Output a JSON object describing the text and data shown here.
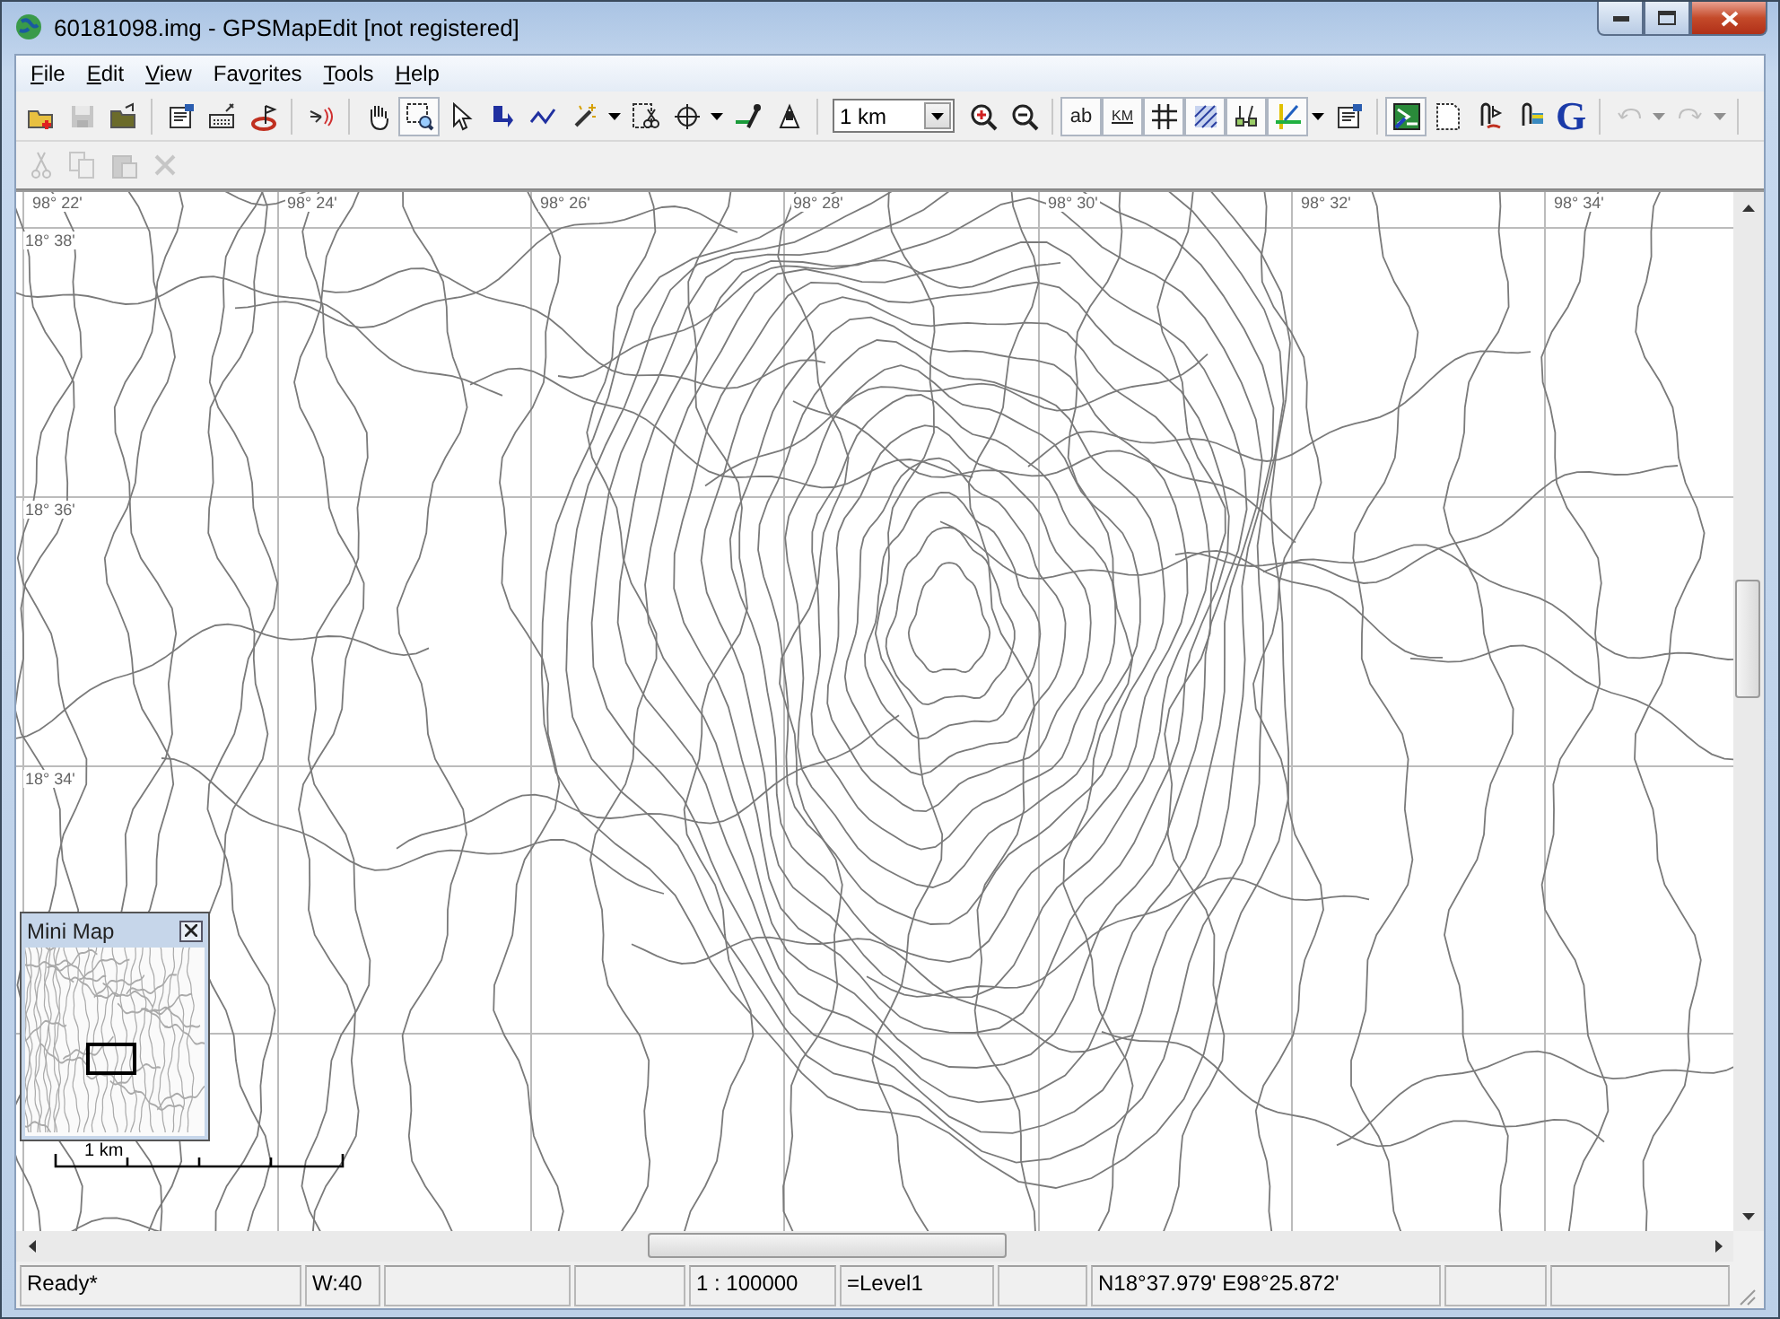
{
  "window": {
    "title": "60181098.img - GPSMapEdit [not registered]"
  },
  "menu": [
    {
      "key": "F",
      "post": "ile"
    },
    {
      "key": "E",
      "post": "dit"
    },
    {
      "key": "V",
      "post": "iew"
    },
    {
      "pre": "Fav",
      "key": "o",
      "post": "rites"
    },
    {
      "key": "T",
      "post": "ools"
    },
    {
      "key": "H",
      "post": "elp"
    }
  ],
  "toolbar": [
    {
      "kind": "button",
      "pressed": false,
      "disabled": false
    },
    {
      "kind": "button",
      "pressed": false,
      "disabled": true
    },
    {
      "kind": "button",
      "pressed": false,
      "disabled": false
    },
    {
      "kind": "separator"
    },
    {
      "kind": "button",
      "pressed": false,
      "disabled": false
    },
    {
      "kind": "button",
      "pressed": false,
      "disabled": false
    },
    {
      "kind": "button",
      "pressed": false,
      "disabled": false
    },
    {
      "kind": "separator"
    },
    {
      "kind": "button",
      "pressed": false,
      "disabled": false
    },
    {
      "kind": "separator"
    },
    {
      "kind": "button",
      "pressed": false,
      "disabled": false
    },
    {
      "kind": "button",
      "pressed": true,
      "disabled": false
    },
    {
      "kind": "button",
      "pressed": false,
      "disabled": false
    },
    {
      "kind": "button",
      "pressed": false,
      "disabled": false
    },
    {
      "kind": "button",
      "pressed": false,
      "disabled": false
    },
    {
      "kind": "button",
      "pressed": false,
      "disabled": false
    },
    {
      "kind": "dropdown",
      "disabled": false
    },
    {
      "kind": "button",
      "pressed": false,
      "disabled": false
    },
    {
      "kind": "button",
      "pressed": false,
      "disabled": false
    },
    {
      "kind": "dropdown",
      "disabled": false
    },
    {
      "kind": "button",
      "pressed": false,
      "disabled": false
    },
    {
      "kind": "button",
      "pressed": false,
      "disabled": false
    },
    {
      "kind": "separator"
    },
    {
      "kind": "combo",
      "value": "1 km"
    },
    {
      "kind": "button",
      "pressed": false,
      "disabled": false
    },
    {
      "kind": "button",
      "pressed": false,
      "disabled": false
    },
    {
      "kind": "separator"
    },
    {
      "kind": "text-button",
      "label": "ab",
      "pressed": true,
      "disabled": false
    },
    {
      "kind": "text-button",
      "label": "KM",
      "pressed": true,
      "disabled": false
    },
    {
      "kind": "button",
      "pressed": true,
      "disabled": false
    },
    {
      "kind": "button",
      "pressed": true,
      "disabled": false
    },
    {
      "kind": "button",
      "pressed": true,
      "disabled": false
    },
    {
      "kind": "button",
      "pressed": true,
      "disabled": false
    },
    {
      "kind": "dropdown",
      "disabled": false
    },
    {
      "kind": "button",
      "pressed": false,
      "disabled": false
    },
    {
      "kind": "separator"
    },
    {
      "kind": "button",
      "pressed": true,
      "disabled": false
    },
    {
      "kind": "button",
      "pressed": false,
      "disabled": false
    },
    {
      "kind": "button",
      "pressed": false,
      "disabled": false
    },
    {
      "kind": "button",
      "pressed": false,
      "disabled": false
    },
    {
      "kind": "text-button",
      "label": "G",
      "pressed": false,
      "disabled": false
    },
    {
      "kind": "separator"
    },
    {
      "kind": "button",
      "pressed": false,
      "disabled": true
    },
    {
      "kind": "dropdown",
      "disabled": true
    },
    {
      "kind": "button",
      "pressed": false,
      "disabled": true
    },
    {
      "kind": "dropdown",
      "disabled": true
    },
    {
      "kind": "separator"
    }
  ],
  "edit_toolbar": [
    {
      "disabled": true
    },
    {
      "disabled": true
    },
    {
      "disabled": true
    },
    {
      "disabled": true
    }
  ],
  "map": {
    "longitude_labels": [
      "98° 22'",
      "98° 24'",
      "98° 26'",
      "98° 28'",
      "98° 30'",
      "98° 32'",
      "98° 34'"
    ],
    "latitude_labels": [
      "18° 38'",
      "18° 36'",
      "18° 34'"
    ]
  },
  "mini_map": {
    "title": "Mini Map"
  },
  "scale_bar": {
    "label": "1 km"
  },
  "status_bar": [
    {
      "text": "Ready*"
    },
    {
      "text": "W:40"
    },
    {
      "text": "1 : 100000"
    },
    {
      "text": "=Level1"
    },
    {
      "text": "N18°37.979' E98°25.872'"
    }
  ]
}
